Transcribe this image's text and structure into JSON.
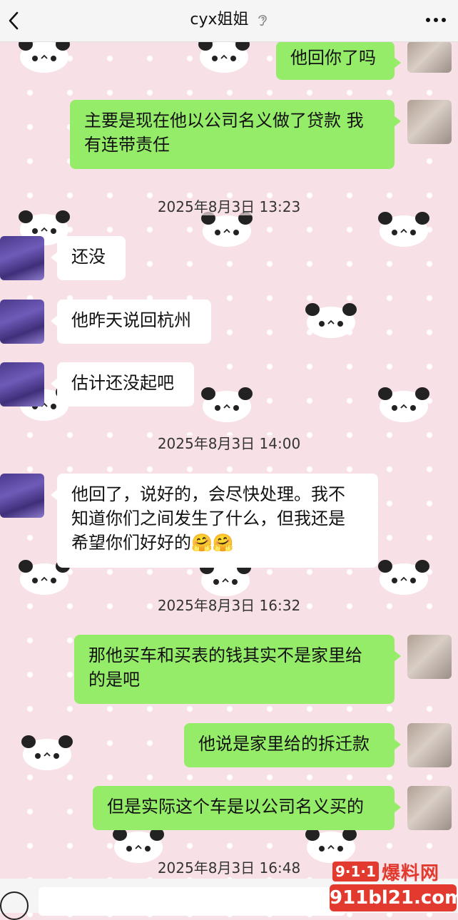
{
  "header": {
    "title": "cyx姐姐",
    "back_icon": "chevron-left-icon",
    "title_icon": "ear-icon",
    "more_icon": "more-horizontal-icon"
  },
  "messages": [
    {
      "side": "right",
      "text": "他回你了吗"
    },
    {
      "side": "right",
      "lines": [
        "主要是现在他以公司名义做了贷款 我",
        "有连带责任"
      ]
    },
    {
      "timestamp": "2025年8月3日 13:23"
    },
    {
      "side": "left",
      "text": "还没"
    },
    {
      "side": "left",
      "text": "他昨天说回杭州"
    },
    {
      "side": "left",
      "text": "估计还没起吧"
    },
    {
      "timestamp": "2025年8月3日 14:00"
    },
    {
      "side": "left",
      "lines": [
        "他回了，说好的，会尽快处理。我不",
        "知道你们之间发生了什么，但我还是",
        "希望你们好好的🤗🤗"
      ]
    },
    {
      "timestamp": "2025年8月3日 16:32"
    },
    {
      "side": "right",
      "lines": [
        "那他买车和买表的钱其实不是家里给",
        "的是吧"
      ]
    },
    {
      "side": "right",
      "text": "他说是家里给的拆迁款"
    },
    {
      "side": "right",
      "text": "但是实际这个车是以公司名义买的"
    },
    {
      "timestamp": "2025年8月3日 16:48"
    }
  ],
  "bottom_bar": {
    "voice_icon": "voice-icon"
  },
  "watermark": {
    "badge": "9·1·1",
    "brand": "爆料网",
    "url": "911bl21.com",
    "color": "#e23a2e"
  },
  "colors": {
    "sent_bubble": "#95ec69",
    "received_bubble": "#ffffff",
    "background": "#f7e1e6"
  }
}
